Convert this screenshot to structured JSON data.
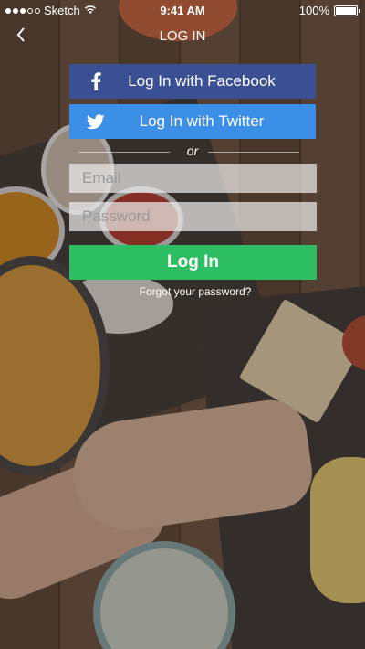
{
  "status_bar": {
    "carrier": "Sketch",
    "time": "9:41 AM",
    "battery": "100%"
  },
  "nav": {
    "back_icon": "chevron-left-icon",
    "title": "LOG IN"
  },
  "social": {
    "facebook_label": "Log In with Facebook",
    "facebook_icon": "facebook-icon",
    "facebook_color": "#3b4f93",
    "twitter_label": "Log In with Twitter",
    "twitter_icon": "twitter-icon",
    "twitter_color": "#3b8fe6"
  },
  "divider": {
    "label": "or"
  },
  "form": {
    "email_placeholder": "Email",
    "email_value": "",
    "password_placeholder": "Password",
    "password_value": "",
    "login_label": "Log In",
    "login_color": "#2ebd62",
    "forgot_label": "Forgot your password?"
  }
}
